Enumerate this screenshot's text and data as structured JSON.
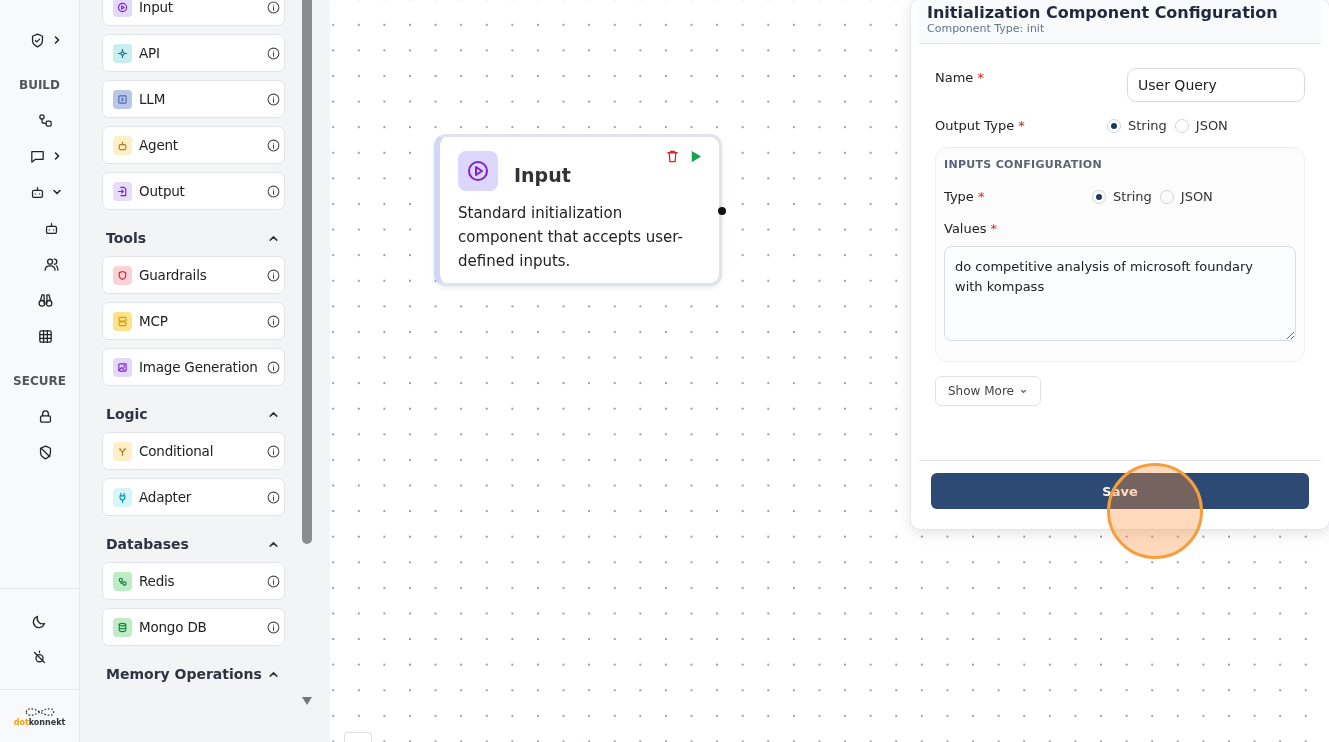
{
  "rail": {
    "groups": [
      {
        "items": [
          {
            "kind": "shield-check",
            "expanded": false
          }
        ]
      },
      {
        "label": "BUILD",
        "items": [
          {
            "kind": "flow"
          },
          {
            "kind": "chat",
            "expanded": false
          },
          {
            "kind": "bot",
            "expanded": true,
            "children": [
              {
                "kind": "bot"
              },
              {
                "kind": "users"
              }
            ]
          },
          {
            "kind": "binoculars"
          },
          {
            "kind": "grid"
          }
        ]
      },
      {
        "label": "SECURE",
        "items": [
          {
            "kind": "lock"
          },
          {
            "kind": "shield-off"
          }
        ]
      }
    ],
    "bottom": [
      {
        "kind": "moon"
      },
      {
        "kind": "sun-off"
      }
    ],
    "logo": {
      "accent": "dot",
      "rest": "konnekt"
    }
  },
  "palette": {
    "groups": [
      {
        "items": [
          {
            "label": "Input",
            "kind": "play",
            "color": "#e3d9fb"
          },
          {
            "label": "API",
            "kind": "api",
            "color": "#c9eef0"
          },
          {
            "label": "LLM",
            "kind": "llm",
            "color": "#b9c6e8"
          },
          {
            "label": "Agent",
            "kind": "bot",
            "color": "#fdf0c7"
          },
          {
            "label": "Output",
            "kind": "output",
            "color": "#e7dcfb"
          }
        ]
      },
      {
        "title": "Tools",
        "expanded": true,
        "items": [
          {
            "label": "Guardrails",
            "kind": "shield",
            "color": "#fbd3d6"
          },
          {
            "label": "MCP",
            "kind": "mcp",
            "color": "#fde28a"
          },
          {
            "label": "Image Generation",
            "kind": "image",
            "color": "#e4d9fb"
          }
        ]
      },
      {
        "title": "Logic",
        "expanded": true,
        "items": [
          {
            "label": "Conditional",
            "kind": "split",
            "color": "#fdf0c7"
          },
          {
            "label": "Adapter",
            "kind": "plug",
            "color": "#d4f6fb"
          }
        ]
      },
      {
        "title": "Databases",
        "expanded": true,
        "items": [
          {
            "label": "Redis",
            "kind": "redis",
            "color": "#bdecc6"
          },
          {
            "label": "Mongo DB",
            "kind": "db",
            "color": "#bdecc6"
          }
        ]
      },
      {
        "title": "Memory Operations",
        "expanded": true
      }
    ]
  },
  "node": {
    "title": "Input",
    "description": "Standard initialization component that accepts user-defined inputs."
  },
  "panel": {
    "title": "Initialization Component Configuration",
    "subtitle": "Component Type: init",
    "required_mark": "*",
    "name": {
      "label": "Name",
      "required": true,
      "value": "User Query"
    },
    "output_type": {
      "label": "Output Type",
      "required": true,
      "options": [
        {
          "label": "String",
          "selected": true
        },
        {
          "label": "JSON",
          "selected": false
        }
      ]
    },
    "inputs": {
      "heading": "INPUTS CONFIGURATION",
      "type": {
        "label": "Type",
        "required": true,
        "options": [
          {
            "label": "String",
            "selected": true
          },
          {
            "label": "JSON",
            "selected": false
          }
        ]
      },
      "values": {
        "label": "Values",
        "required": true,
        "value": "do competitive analysis of microsoft foundary with kompass"
      }
    },
    "show_more": "Show More",
    "save": "Save"
  }
}
